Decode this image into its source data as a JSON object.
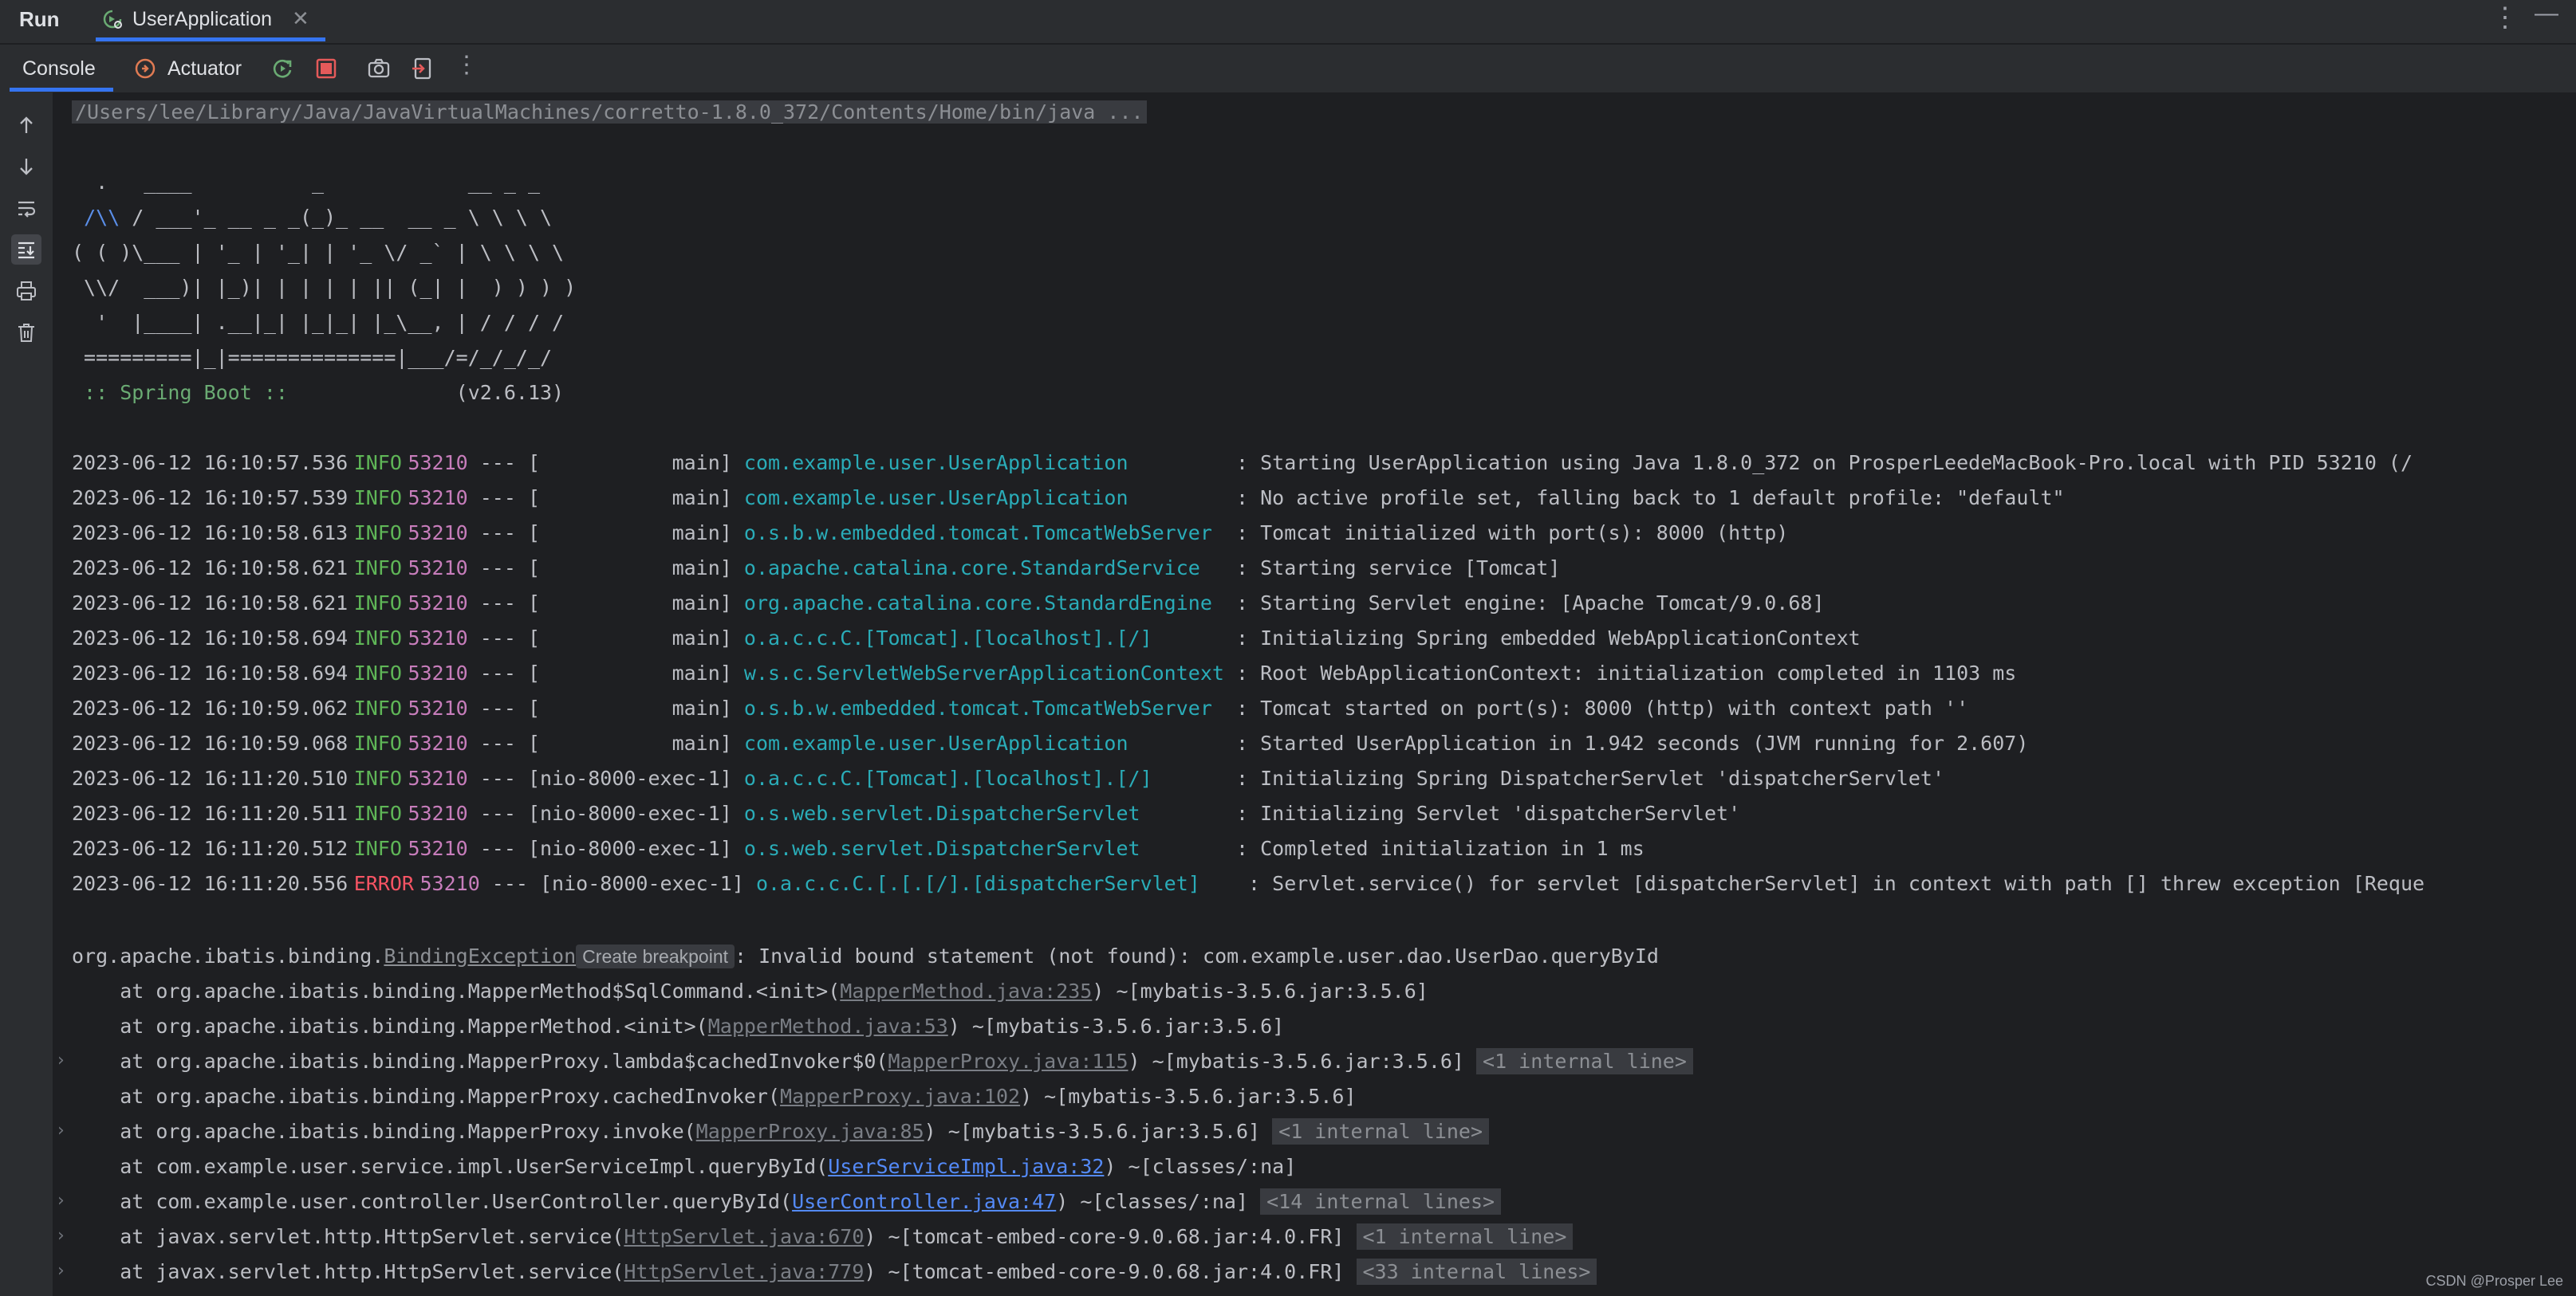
{
  "topbar": {
    "run_label": "Run",
    "tab_label": "UserApplication",
    "close_glyph": "✕",
    "more_glyph": "⋮",
    "minimize_glyph": "—"
  },
  "toolbar": {
    "console_tab": "Console",
    "actuator_tab": "Actuator",
    "more_glyph": "⋮",
    "icons": [
      "rerun-icon",
      "stop-icon",
      "screenshot-icon",
      "exit-icon",
      "more-icon"
    ],
    "accent": "#3574f0"
  },
  "gutter": {
    "icons": [
      "arrow-up-icon",
      "arrow-down-icon",
      "soft-wrap-icon",
      "scroll-to-end-icon",
      "print-icon",
      "clear-icon"
    ]
  },
  "console": {
    "command": "/Users/lee/Library/Java/JavaVirtualMachines/corretto-1.8.0_372/Contents/Home/bin/java ...",
    "banner": {
      "line1": "  .   ____          _            __ _ _",
      "line2_pre": " ",
      "line2_blue": "/\\\\",
      "line2_post": " / ___'_ __ _ _(_)_ __  __ _ \\ \\ \\ \\",
      "line3": "( ( )\\___ | '_ | '_| | '_ \\/ _` | \\ \\ \\ \\",
      "line4": " \\\\/  ___)| |_)| | | | | || (_| |  ) ) ) )",
      "line5": "  '  |____| .__|_| |_|_| |_\\__, | / / / /",
      "line6": " =========|_|==============|___/=/_/_/_/",
      "spring_label": " :: Spring Boot :: ",
      "spring_version": "             (v2.6.13)"
    },
    "logs": [
      {
        "ts": "2023-06-12 16:10:57.536",
        "level": "INFO",
        "pid": "53210",
        "thread": " --- [           main] ",
        "logger": "com.example.user.UserApplication        ",
        "msg": " : Starting UserApplication using Java 1.8.0_372 on ProsperLeedeMacBook-Pro.local with PID 53210 (/"
      },
      {
        "ts": "2023-06-12 16:10:57.539",
        "level": "INFO",
        "pid": "53210",
        "thread": " --- [           main] ",
        "logger": "com.example.user.UserApplication        ",
        "msg": " : No active profile set, falling back to 1 default profile: \"default\""
      },
      {
        "ts": "2023-06-12 16:10:58.613",
        "level": "INFO",
        "pid": "53210",
        "thread": " --- [           main] ",
        "logger": "o.s.b.w.embedded.tomcat.TomcatWebServer ",
        "msg": " : Tomcat initialized with port(s): 8000 (http)"
      },
      {
        "ts": "2023-06-12 16:10:58.621",
        "level": "INFO",
        "pid": "53210",
        "thread": " --- [           main] ",
        "logger": "o.apache.catalina.core.StandardService  ",
        "msg": " : Starting service [Tomcat]"
      },
      {
        "ts": "2023-06-12 16:10:58.621",
        "level": "INFO",
        "pid": "53210",
        "thread": " --- [           main] ",
        "logger": "org.apache.catalina.core.StandardEngine ",
        "msg": " : Starting Servlet engine: [Apache Tomcat/9.0.68]"
      },
      {
        "ts": "2023-06-12 16:10:58.694",
        "level": "INFO",
        "pid": "53210",
        "thread": " --- [           main] ",
        "logger": "o.a.c.c.C.[Tomcat].[localhost].[/]      ",
        "msg": " : Initializing Spring embedded WebApplicationContext"
      },
      {
        "ts": "2023-06-12 16:10:58.694",
        "level": "INFO",
        "pid": "53210",
        "thread": " --- [           main] ",
        "logger": "w.s.c.ServletWebServerApplicationContext",
        "msg": " : Root WebApplicationContext: initialization completed in 1103 ms"
      },
      {
        "ts": "2023-06-12 16:10:59.062",
        "level": "INFO",
        "pid": "53210",
        "thread": " --- [           main] ",
        "logger": "o.s.b.w.embedded.tomcat.TomcatWebServer ",
        "msg": " : Tomcat started on port(s): 8000 (http) with context path ''"
      },
      {
        "ts": "2023-06-12 16:10:59.068",
        "level": "INFO",
        "pid": "53210",
        "thread": " --- [           main] ",
        "logger": "com.example.user.UserApplication        ",
        "msg": " : Started UserApplication in 1.942 seconds (JVM running for 2.607)"
      },
      {
        "ts": "2023-06-12 16:11:20.510",
        "level": "INFO",
        "pid": "53210",
        "thread": " --- [nio-8000-exec-1] ",
        "logger": "o.a.c.c.C.[Tomcat].[localhost].[/]      ",
        "msg": " : Initializing Spring DispatcherServlet 'dispatcherServlet'"
      },
      {
        "ts": "2023-06-12 16:11:20.511",
        "level": "INFO",
        "pid": "53210",
        "thread": " --- [nio-8000-exec-1] ",
        "logger": "o.s.web.servlet.DispatcherServlet       ",
        "msg": " : Initializing Servlet 'dispatcherServlet'"
      },
      {
        "ts": "2023-06-12 16:11:20.512",
        "level": "INFO",
        "pid": "53210",
        "thread": " --- [nio-8000-exec-1] ",
        "logger": "o.s.web.servlet.DispatcherServlet       ",
        "msg": " : Completed initialization in 1 ms"
      },
      {
        "ts": "2023-06-12 16:11:20.556",
        "level": "ERROR",
        "pid": "53210",
        "thread": " --- [nio-8000-exec-1] ",
        "logger": "o.a.c.c.C.[.[.[/].[dispatcherServlet]   ",
        "msg": " : Servlet.service() for servlet [dispatcherServlet] in context with path [] threw exception [Reque"
      }
    ],
    "exception": {
      "prefix": "org.apache.ibatis.binding.",
      "class": "BindingException",
      "tooltip": "Create breakpoint",
      "message": ": Invalid bound statement (not found): com.example.user.dao.UserDao.queryById"
    },
    "stack": [
      {
        "fold": false,
        "pre": "    at org.apache.ibatis.binding.MapperMethod$SqlCommand.<init>(",
        "link": "MapperMethod.java:235",
        "link_style": "muted",
        "post": ") ~[mybatis-3.5.6.jar:3.5.6]",
        "internal": ""
      },
      {
        "fold": false,
        "pre": "    at org.apache.ibatis.binding.MapperMethod.<init>(",
        "link": "MapperMethod.java:53",
        "link_style": "muted",
        "post": ") ~[mybatis-3.5.6.jar:3.5.6]",
        "internal": ""
      },
      {
        "fold": true,
        "pre": "    at org.apache.ibatis.binding.MapperProxy.lambda$cachedInvoker$0(",
        "link": "MapperProxy.java:115",
        "link_style": "muted",
        "post": ") ~[mybatis-3.5.6.jar:3.5.6] ",
        "internal": "<1 internal line>"
      },
      {
        "fold": false,
        "pre": "    at org.apache.ibatis.binding.MapperProxy.cachedInvoker(",
        "link": "MapperProxy.java:102",
        "link_style": "muted",
        "post": ") ~[mybatis-3.5.6.jar:3.5.6]",
        "internal": ""
      },
      {
        "fold": true,
        "pre": "    at org.apache.ibatis.binding.MapperProxy.invoke(",
        "link": "MapperProxy.java:85",
        "link_style": "muted",
        "post": ") ~[mybatis-3.5.6.jar:3.5.6] ",
        "internal": "<1 internal line>"
      },
      {
        "fold": false,
        "pre": "    at com.example.user.service.impl.UserServiceImpl.queryById(",
        "link": "UserServiceImpl.java:32",
        "link_style": "blue",
        "post": ") ~[classes/:na]",
        "internal": ""
      },
      {
        "fold": true,
        "pre": "    at com.example.user.controller.UserController.queryById(",
        "link": "UserController.java:47",
        "link_style": "blue",
        "post": ") ~[classes/:na] ",
        "internal": "<14 internal lines>"
      },
      {
        "fold": true,
        "pre": "    at javax.servlet.http.HttpServlet.service(",
        "link": "HttpServlet.java:670",
        "link_style": "muted",
        "post": ") ~[tomcat-embed-core-9.0.68.jar:4.0.FR] ",
        "internal": "<1 internal line>"
      },
      {
        "fold": true,
        "pre": "    at javax.servlet.http.HttpServlet.service(",
        "link": "HttpServlet.java:779",
        "link_style": "muted",
        "post": ") ~[tomcat-embed-core-9.0.68.jar:4.0.FR] ",
        "internal": "<33 internal lines>"
      }
    ],
    "fold_glyph": "›"
  },
  "watermark": "CSDN @Prosper Lee"
}
